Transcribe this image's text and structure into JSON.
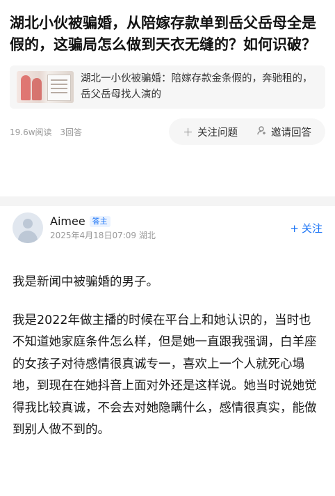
{
  "question": {
    "title": "湖北小伙被骗婚，从陪嫁存款单到岳父岳母全是假的，这骗局怎么做到天衣无缝的？如何识破？",
    "related": {
      "text": "湖北一小伙被骗婚：陪嫁存款金条假的，奔驰租的，岳父岳母找人演的"
    },
    "stats": {
      "views": "19.6w阅读",
      "answers": "3回答"
    },
    "actions": {
      "follow_label": "关注问题",
      "invite_label": "邀请回答"
    }
  },
  "answer": {
    "author": {
      "name": "Aimee",
      "badge": "答主",
      "meta": "2025年4月18日07:09 湖北"
    },
    "follow_label": "关注",
    "paragraphs": [
      "我是新闻中被骗婚的男子。",
      "我是2022年做主播的时候在平台上和她认识的，当时也不知道她家庭条件怎么样，但是她一直跟我强调，白羊座的女孩子对待感情很真诚专一，喜欢上一个人就死心塌地，到现在在她抖音上面对外还是这样说。她当时说她觉得我比较真诚，不会去对她隐瞒什么，感情很真实，能做到别人做不到的。"
    ]
  },
  "icons": {
    "follow_question": "plus-icon",
    "invite": "person-icon",
    "follow_author": "plus-icon"
  },
  "colors": {
    "accent": "#1772f6",
    "muted": "#999999"
  }
}
